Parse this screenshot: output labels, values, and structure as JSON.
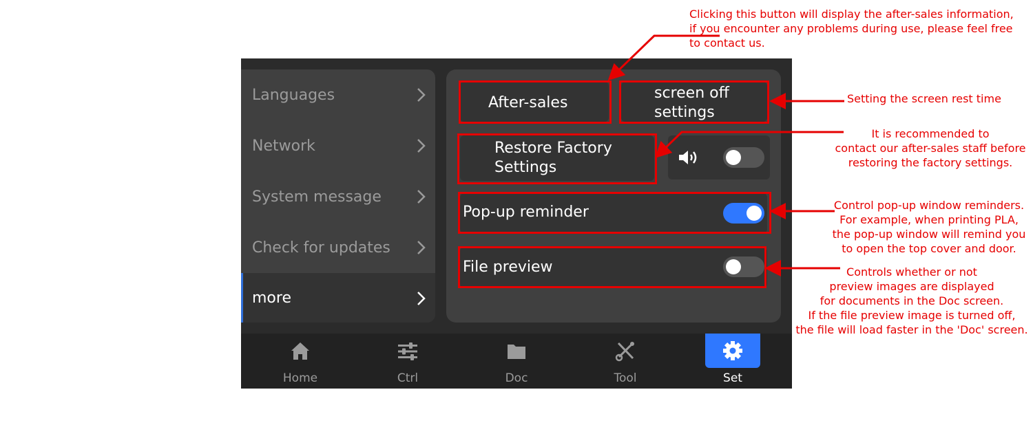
{
  "sidebar": {
    "items": [
      {
        "label": "Languages"
      },
      {
        "label": "Network"
      },
      {
        "label": "System message"
      },
      {
        "label": "Check for updates"
      },
      {
        "label": "more",
        "active": true
      }
    ]
  },
  "settings": {
    "after_sales_label": "After-sales",
    "screen_off_line1": "screen off",
    "screen_off_line2": "settings",
    "restore_line1": "Restore Factory",
    "restore_line2": "Settings",
    "sound_on": false,
    "popup_label": "Pop-up reminder",
    "popup_on": true,
    "preview_label": "File preview",
    "preview_on": false
  },
  "nav": {
    "items": [
      {
        "label": "Home",
        "icon": "home-icon"
      },
      {
        "label": "Ctrl",
        "icon": "sliders-icon"
      },
      {
        "label": "Doc",
        "icon": "folder-icon"
      },
      {
        "label": "Tool",
        "icon": "tools-icon"
      },
      {
        "label": "Set",
        "icon": "gear-icon",
        "active": true
      }
    ]
  },
  "annotations": {
    "after_sales": [
      "Clicking this button will display the after-sales information,",
      "if you encounter any problems during use, please feel free",
      "to contact us."
    ],
    "screen_off": [
      "Setting the screen rest time"
    ],
    "restore": [
      "It is recommended to",
      "contact our after-sales staff before",
      "restoring the factory settings."
    ],
    "popup": [
      "Control pop-up window reminders.",
      "For example, when printing PLA,",
      "the pop-up window will remind you",
      "to open the top cover and door."
    ],
    "preview": [
      "Controls whether or not",
      "preview images are displayed",
      "for documents in the Doc screen.",
      "If the file preview image is turned off,",
      "the file will load faster in the 'Doc' screen."
    ]
  },
  "colors": {
    "accent": "#2f78ff",
    "annotation": "#e60000",
    "panel": "#404040",
    "card": "#333333"
  }
}
